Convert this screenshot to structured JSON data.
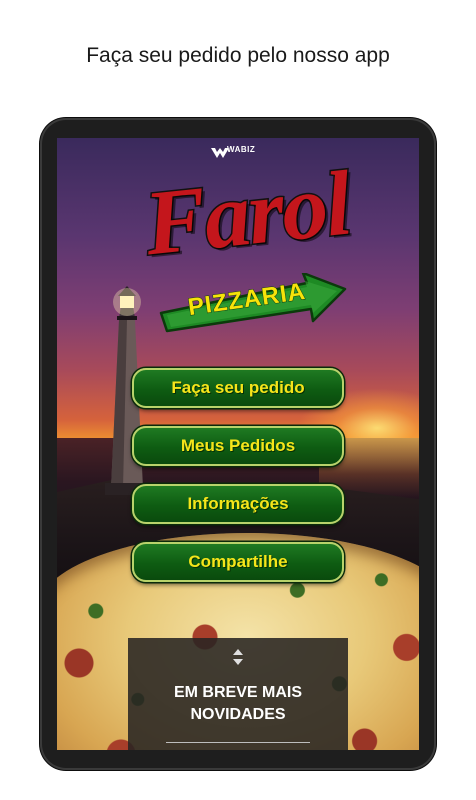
{
  "headline": "Faça seu pedido pelo nosso app",
  "app": {
    "brand_logo_text": "WABIZ",
    "logo_title": "Farol",
    "logo_subtitle": "PIZZARIA",
    "menu": [
      {
        "label": "Faça seu pedido"
      },
      {
        "label": "Meus Pedidos"
      },
      {
        "label": "Informações"
      },
      {
        "label": "Compartilhe"
      }
    ],
    "news": {
      "handle_icon": "up-down-arrows-icon",
      "title": "EM BREVE MAIS NOVIDADES"
    }
  },
  "colors": {
    "button_bg": "#0e5c12",
    "button_text": "#f5e51a",
    "logo_red": "#c4161c",
    "pizzaria_yellow": "#f7e30a"
  }
}
